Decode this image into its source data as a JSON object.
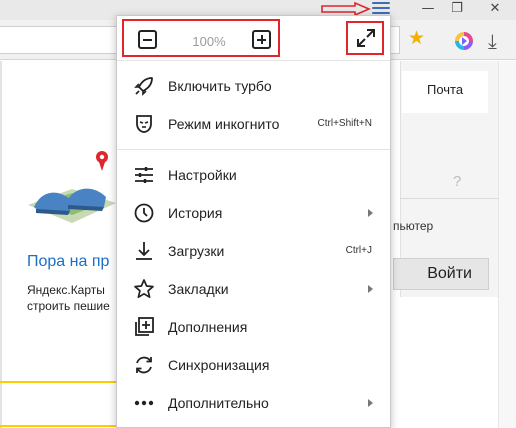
{
  "zoom": {
    "value": "100%"
  },
  "menu": {
    "items": [
      {
        "label": "Включить турбо",
        "shortcut": "",
        "submenu": false,
        "icon": "rocket-icon"
      },
      {
        "label": "Режим инкогнито",
        "shortcut": "Ctrl+Shift+N",
        "submenu": false,
        "icon": "incognito-mask-icon"
      },
      {
        "label": "Настройки",
        "shortcut": "",
        "submenu": false,
        "icon": "sliders-icon"
      },
      {
        "label": "История",
        "shortcut": "",
        "submenu": true,
        "icon": "clock-icon"
      },
      {
        "label": "Загрузки",
        "shortcut": "Ctrl+J",
        "submenu": false,
        "icon": "download-icon"
      },
      {
        "label": "Закладки",
        "shortcut": "",
        "submenu": true,
        "icon": "star-outline-icon"
      },
      {
        "label": "Дополнения",
        "shortcut": "",
        "submenu": false,
        "icon": "extensions-icon"
      },
      {
        "label": "Синхронизация",
        "shortcut": "",
        "submenu": false,
        "icon": "sync-icon"
      },
      {
        "label": "Дополнительно",
        "shortcut": "",
        "submenu": true,
        "icon": "more-dots-icon"
      }
    ]
  },
  "page": {
    "promo_title": "Пора на пр",
    "promo_text_1": "Яндекс.Карты",
    "promo_text_2": "строить пешие",
    "mail_tab": "Почта",
    "help_mark": "?",
    "computer_text": "пьютер",
    "login_button": "Войти"
  },
  "window": {
    "minimize": "—",
    "maximize": "❐",
    "close": "✕"
  },
  "colors": {
    "annotation_red": "#e0262d",
    "link_blue": "#1a6ec8",
    "accent_yellow": "#ffcc00",
    "star_gold": "#f2b100"
  }
}
